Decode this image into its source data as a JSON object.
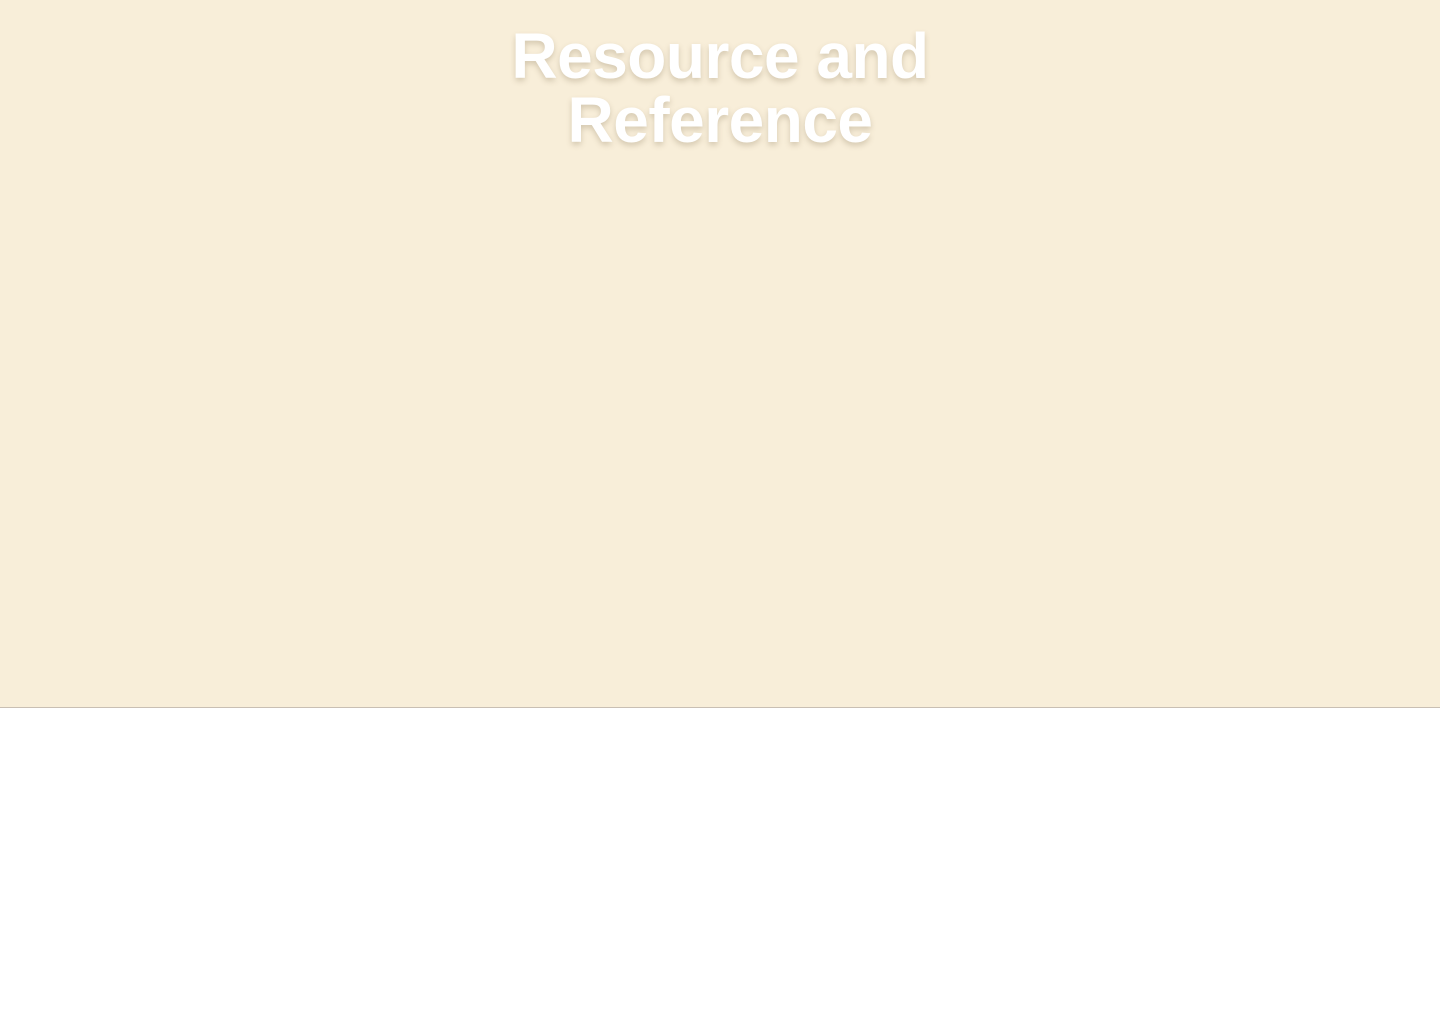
{
  "hero": {
    "title_line_1": "Resource and",
    "title_line_2": "Reference",
    "background_color": "#f8eed9",
    "title_color": "#ffffff"
  },
  "page": {
    "background_color": "#ffffff"
  }
}
